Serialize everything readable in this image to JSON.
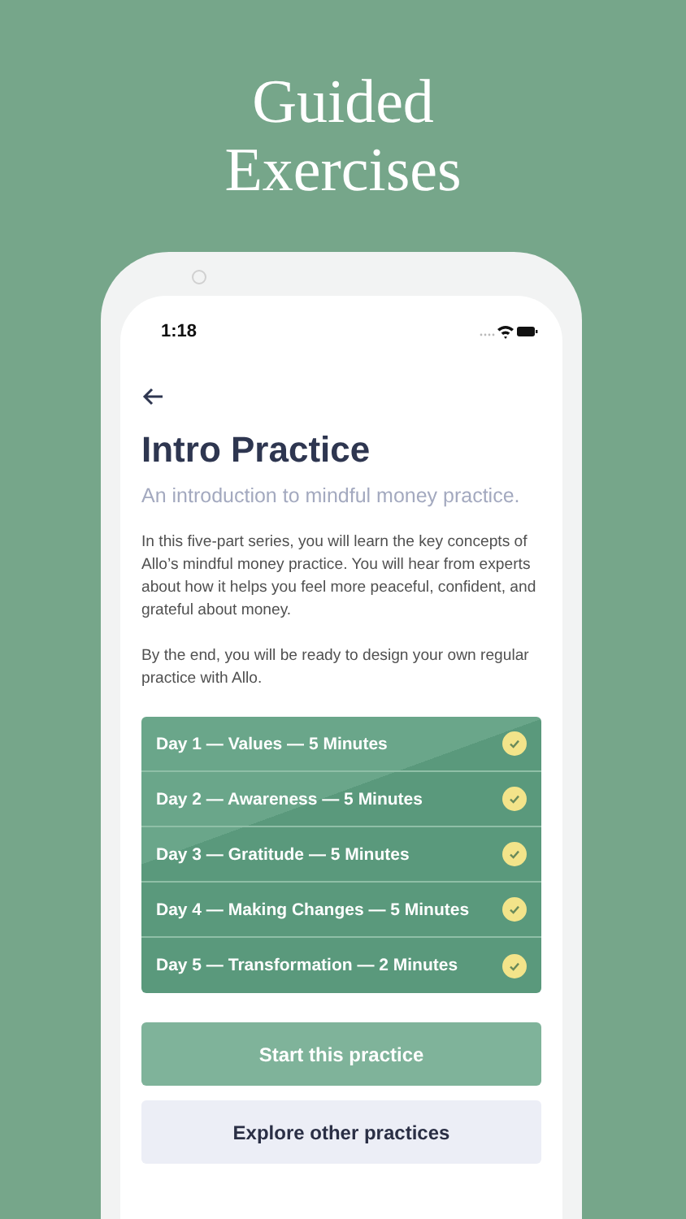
{
  "headline": "Guided Exercises",
  "status_bar": {
    "time": "1:18"
  },
  "title": "Intro Practice",
  "subtitle": "An introduction to mindful money practice.",
  "paragraphs": [
    "In this five-part series, you will learn the key concepts of Allo’s mindful money practice. You will hear from experts about how it helps you feel more peaceful, confident, and grateful about money.",
    "By the end, you will be ready to design your own regular practice with Allo."
  ],
  "days": [
    {
      "label": "Day 1 — Values — 5 Minutes",
      "completed": true
    },
    {
      "label": "Day 2 — Awareness — 5 Minutes",
      "completed": true
    },
    {
      "label": "Day 3 — Gratitude — 5 Minutes",
      "completed": true
    },
    {
      "label": "Day 4 — Making Changes — 5 Minutes",
      "completed": true
    },
    {
      "label": "Day 5 — Transformation — 2 Minutes",
      "completed": true
    }
  ],
  "buttons": [
    {
      "label": "Start this practice",
      "kind": "primary"
    },
    {
      "label": "Explore other practices",
      "kind": "secondary"
    }
  ]
}
